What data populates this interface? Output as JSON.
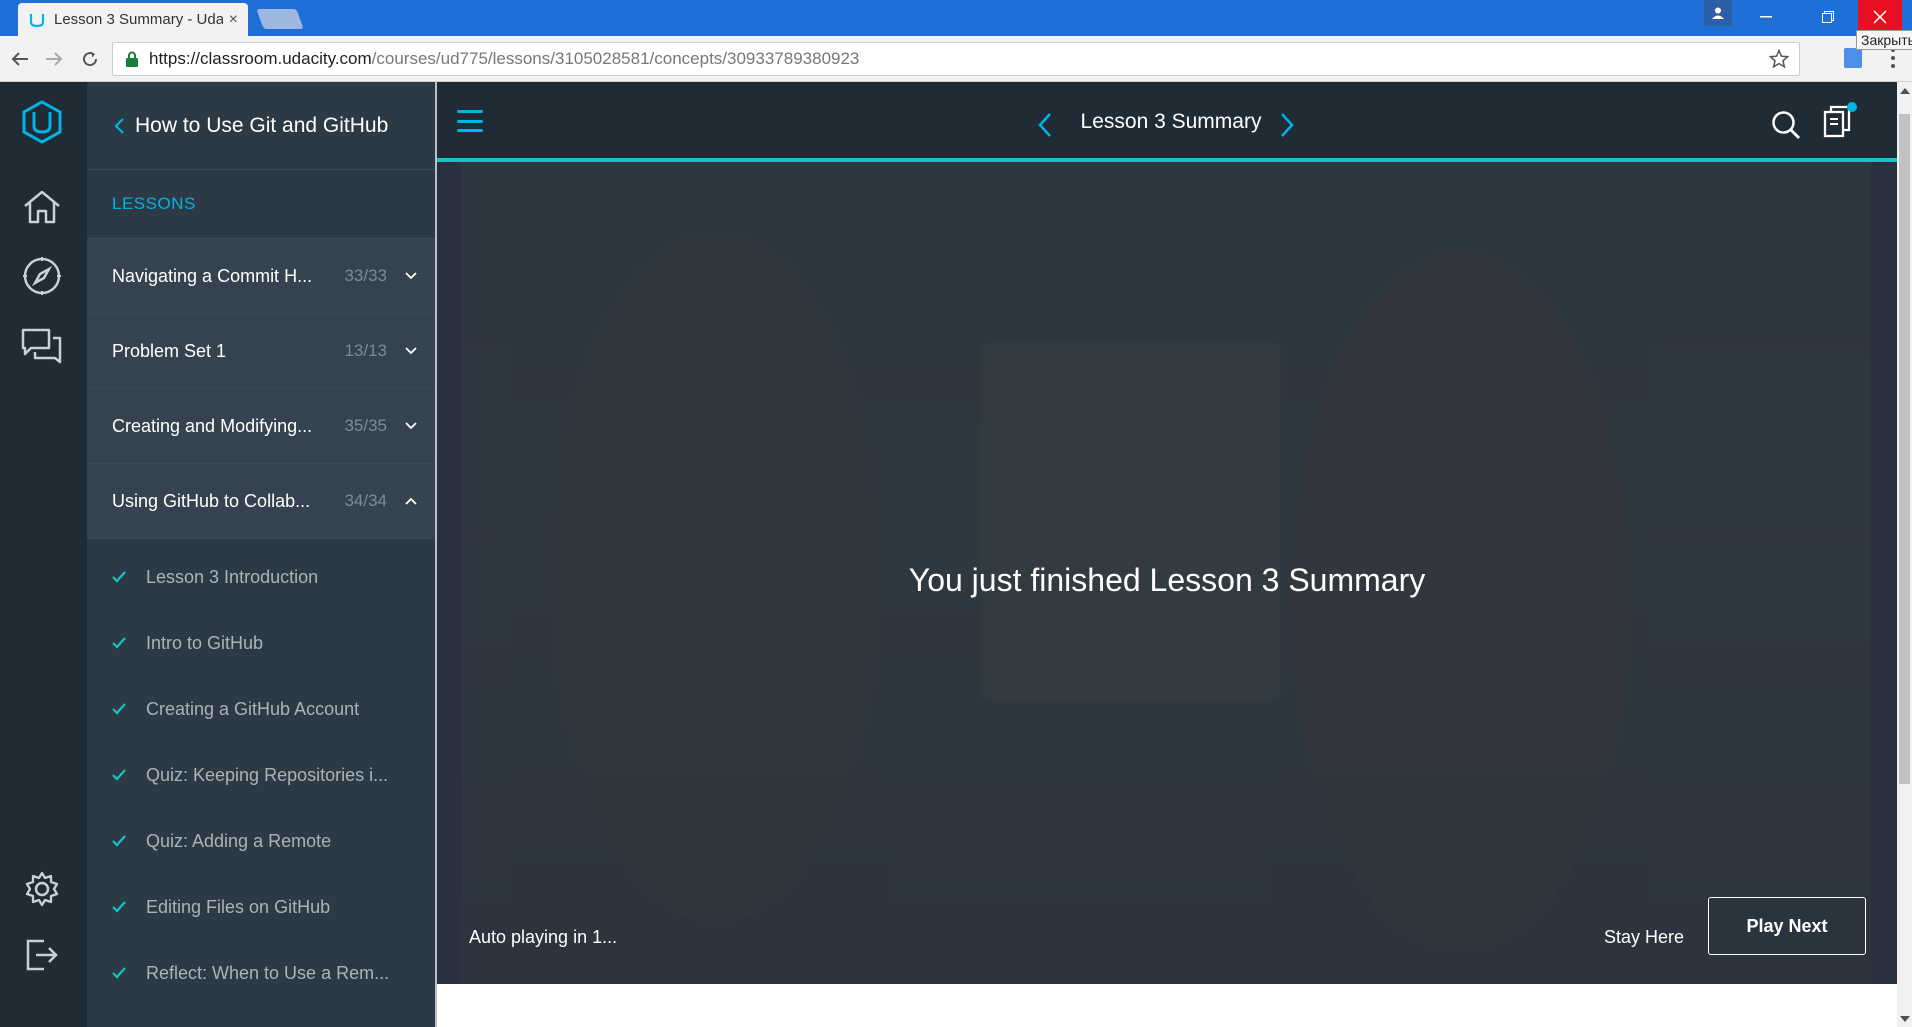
{
  "browser": {
    "tab_title": "Lesson 3 Summary - Uda",
    "tab_close": "×",
    "url_host": "https://classroom.udacity.com",
    "url_path": "/courses/ud775/lessons/3105028581/concepts/30933789380923",
    "close_tooltip": "Закрыть"
  },
  "course": {
    "title": "How to Use Git and GitHub",
    "lessons_label": "LESSONS"
  },
  "lessons": [
    {
      "name": "Navigating a Commit H...",
      "count": "33/33",
      "expanded": false
    },
    {
      "name": "Problem Set 1",
      "count": "13/13",
      "expanded": false
    },
    {
      "name": "Creating and Modifying...",
      "count": "35/35",
      "expanded": false
    },
    {
      "name": "Using GitHub to Collab...",
      "count": "34/34",
      "expanded": true
    }
  ],
  "concepts": [
    "Lesson 3 Introduction",
    "Intro to GitHub",
    "Creating a GitHub Account",
    "Quiz: Keeping Repositories i...",
    "Quiz: Adding a Remote",
    "Editing Files on GitHub",
    "Reflect: When to Use a Rem..."
  ],
  "topbar": {
    "concept_title": "Lesson 3 Summary"
  },
  "player": {
    "finished_message": "You just finished Lesson 3 Summary",
    "autoplay_text": "Auto playing in  1...",
    "stay_here": "Stay Here",
    "play_next": "Play Next"
  },
  "colors": {
    "brand_blue": "#02b3e4",
    "accent_teal": "#15c4c4",
    "rail_bg": "#1f2b35",
    "sidebar_bg": "#2c3a46"
  }
}
